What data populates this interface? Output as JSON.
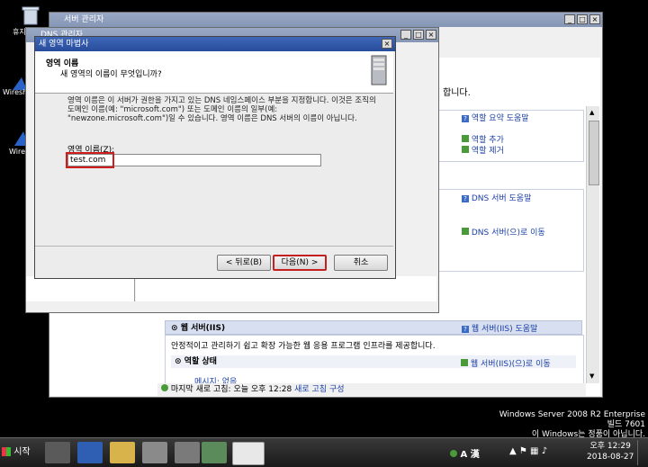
{
  "desktop": {
    "icons": [
      {
        "name": "recycle-bin",
        "label": "휴지통"
      },
      {
        "name": "wireshark-1",
        "label": "Wiresh"
      },
      {
        "name": "wireshark-2",
        "label": "Wiresh"
      }
    ],
    "watermark": {
      "line1": "Windows Server 2008 R2 Enterprise",
      "line2": "빌드 7601",
      "line3": "이 Windows는 정품이 아닙니다."
    }
  },
  "server_manager": {
    "title": "서버 관리자",
    "text_snippet": "합니다.",
    "side_text": [
      "드록",
      "관리",
      "사정"
    ],
    "sections": {
      "roles_links": {
        "help": "역할 요약 도움말",
        "add": "역할 추가",
        "remove": "역할 제거"
      },
      "dns_links": {
        "help": "DNS 서버 도움말",
        "goto": "DNS 서버(으)로 이동"
      },
      "iis": {
        "title": "웹 서버(IIS)",
        "help": "웹 서버(IIS) 도움말",
        "description": "안정적이고 관리하기 쉽고 확장 가능한 웹 응용 프로그램 인프라를 제공합니다.",
        "role_status": "역할 상태",
        "goto": "웹 서버(IIS)(으)로 이동",
        "message": "메시지: 없음"
      }
    },
    "status_bar": {
      "last_refresh": "마지막 새로 고침: 오늘 오후 12:28",
      "configure": "새로 고침 구성"
    }
  },
  "dns_manager": {
    "title": "DNS 관리자"
  },
  "wizard": {
    "title": "새 영역 마법사",
    "header_title": "영역 이름",
    "header_subtitle": "새 영역의 이름이 무엇입니까?",
    "description": "영역 이름은 이 서버가 권한을 가지고 있는 DNS 네임스페이스 부분을 지정합니다. 이것은 조직의 도메인 이름(예: \"microsoft.com\") 또는 도메인 이름의 일부(예: \"newzone.microsoft.com\")일 수 있습니다. 영역 이름은 DNS 서버의 이름이 아닙니다.",
    "zone_label": "영역 이름(Z):",
    "zone_value": "test.com",
    "buttons": {
      "back": "< 뒤로(B)",
      "next": "다음(N) >",
      "cancel": "취소"
    }
  },
  "taskbar": {
    "start_label": "시작",
    "ime": "A 漢",
    "time": "오후 12:29",
    "date": "2018-08-27"
  }
}
